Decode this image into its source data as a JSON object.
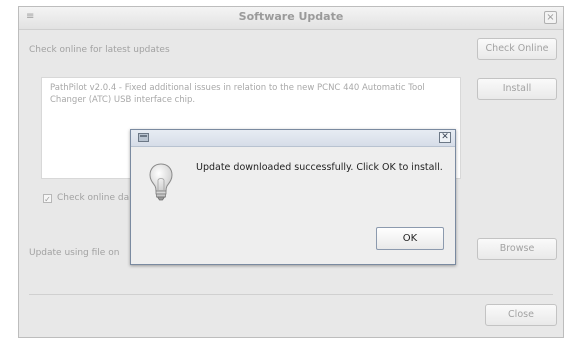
{
  "main_window": {
    "title": "Software Update",
    "close_glyph": "×",
    "app_icon_glyph": "≡",
    "check_online_label": "Check online for latest updates",
    "check_online_button": "Check Online",
    "install_button": "Install",
    "notes_text": "PathPilot v2.0.4 - Fixed additional issues in relation to the new PCNC 440 Automatic Tool Changer (ATC) USB interface chip.",
    "checkbox_label": "Check online da",
    "checkbox_checked_glyph": "✓",
    "update_file_label": "Update using file on",
    "browse_button": "Browse",
    "close_button": "Close"
  },
  "dialog": {
    "close_glyph": "✕",
    "message": "Update downloaded successfully.  Click OK to install.",
    "ok_button": "OK",
    "icon": "lightbulb-icon"
  }
}
